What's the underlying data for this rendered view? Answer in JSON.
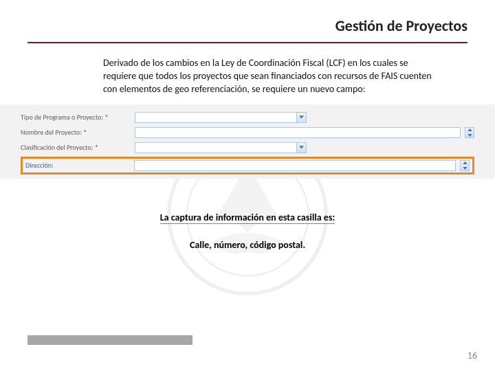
{
  "header": {
    "title": "Gestión de Proyectos"
  },
  "intro": "Derivado de los cambios en la Ley de Coordinación Fiscal (LCF) en los cuales se requiere que todos los proyectos que sean financiados con recursos de FAIS cuenten con elementos de geo referenciación, se requiere un nuevo campo:",
  "form": {
    "row1": {
      "label": "Tipo de Programa o Proyecto:",
      "required": "*"
    },
    "row2": {
      "label": "Nombre del Proyecto:",
      "required": "*"
    },
    "row3": {
      "label": "Clasificación del Proyecto:",
      "required": "*"
    },
    "row4": {
      "label": "Dirección:"
    }
  },
  "caption1": "La captura de información en esta casilla es:",
  "caption2": "Calle, número, código postal.",
  "pageNumber": "16"
}
